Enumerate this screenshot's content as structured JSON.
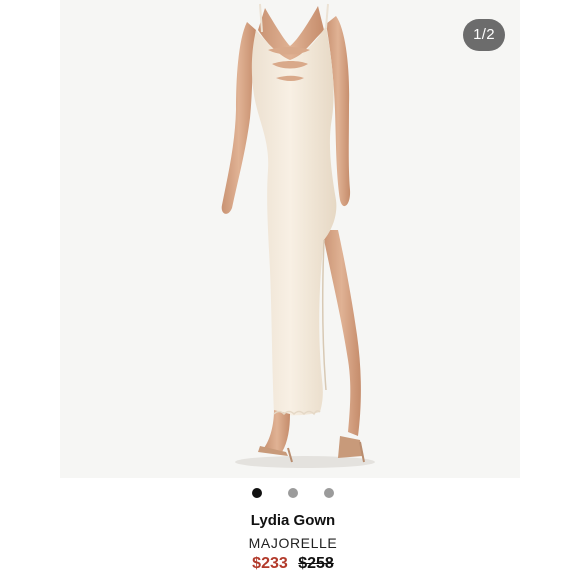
{
  "carousel": {
    "counter_label": "1/2",
    "dot_count": 3,
    "active_index": 0
  },
  "product": {
    "name": "Lydia Gown",
    "brand": "MAJORELLE",
    "sale_price": "$233",
    "original_price": "$258"
  },
  "colors": {
    "sale_price": "#b23a2b",
    "dress": "#f3e9dc",
    "background": "#f6f6f4",
    "skin": "#d9a98a"
  },
  "icons": {
    "product_image": "dress-photo"
  }
}
